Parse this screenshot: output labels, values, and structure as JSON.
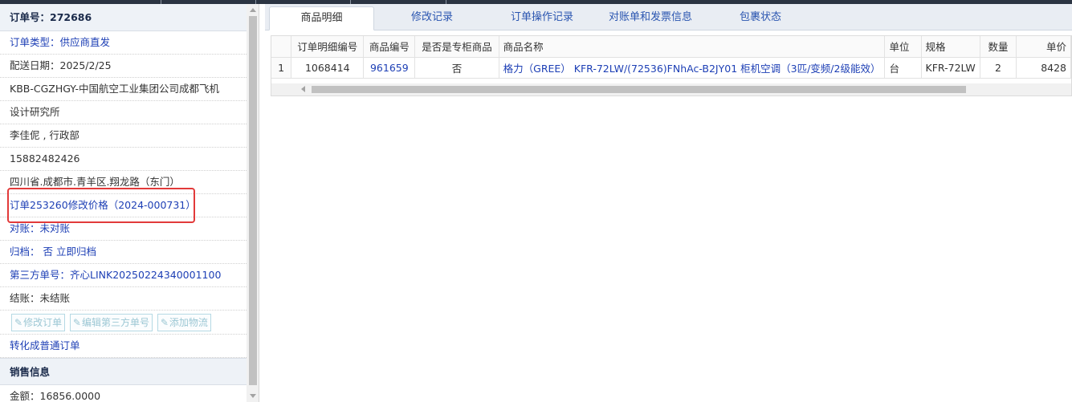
{
  "order_panel": {
    "order_no": "订单号：272686",
    "order_type": "订单类型：供应商直发",
    "delivery_date": "配送日期：2025/2/25",
    "company_line1": "KBB-CGZHGY-中国航空工业集团公司成都飞机",
    "company_line2": "设计研究所",
    "contact": "李佳伲 , 行政部",
    "phone": "15882482426",
    "address": "四川省.成都市.青羊区.翔龙路（东门）",
    "price_change": "订单253260修改价格（2024-000731）",
    "reconcile": "对账：未对账",
    "archive_label": "归档：",
    "archive_value": "否",
    "archive_link": "立即归档",
    "third_party": "第三方单号：齐心LINK20250224340001100",
    "settlement": "结账：未结账",
    "buttons": {
      "edit_order": "修改订单",
      "edit_third_party": "编辑第三方单号",
      "add_logistics": "添加物流"
    },
    "convert": "转化成普通订单",
    "sales_section": "销售信息",
    "amount": "金额：16856.0000"
  },
  "tabs": [
    "商品明细",
    "修改记录",
    "订单操作记录",
    "对账单和发票信息",
    "包裹状态"
  ],
  "table": {
    "columns": [
      "订单明细编号",
      "商品编号",
      "是否是专柜商品",
      "商品名称",
      "单位",
      "规格",
      "数量",
      "单价"
    ],
    "rows": [
      {
        "index": "1",
        "detail_id": "1068414",
        "product_id": "961659",
        "is_counter": "否",
        "name": "格力（GREE） KFR-72LW/(72536)FNhAc-B2JY01 柜机空调（3匹/变频/2级能效）",
        "unit": "台",
        "spec": "KFR-72LW",
        "qty": "2",
        "price": "8428"
      }
    ]
  },
  "icons": {
    "edit": "edit-icon"
  }
}
